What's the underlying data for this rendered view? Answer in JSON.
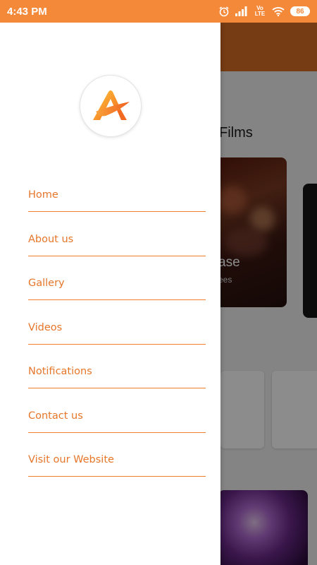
{
  "status_bar": {
    "time": "4:43 PM",
    "network_label": "Vo LTE",
    "battery": "86",
    "icons": [
      "alarm-icon",
      "signal-icon",
      "volte-icon",
      "wifi-icon",
      "battery-icon"
    ]
  },
  "background_screen": {
    "section_title": "Films",
    "card_title": "ase",
    "card_subtitle": "ees"
  },
  "drawer": {
    "logo": "app-logo-icon",
    "menu": [
      {
        "label": "Home"
      },
      {
        "label": "About us"
      },
      {
        "label": "Gallery"
      },
      {
        "label": "Videos"
      },
      {
        "label": "Notifications"
      },
      {
        "label": "Contact us"
      },
      {
        "label": "Visit our Website"
      }
    ]
  },
  "colors": {
    "status_bar": "#f4893a",
    "accent": "#e6762a",
    "header_bg": "#d86e25",
    "drawer_bg": "#ffffff"
  }
}
